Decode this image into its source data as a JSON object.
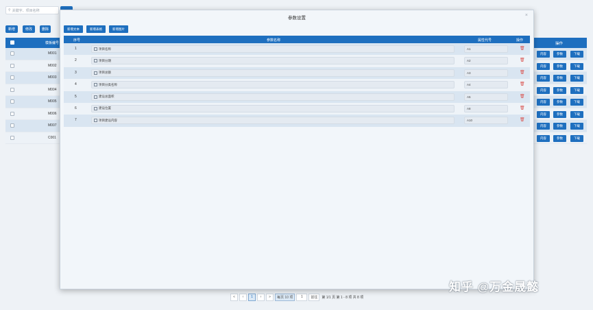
{
  "background": {
    "search": {
      "placeholder": "关键字、项目名称"
    },
    "toolbar": [
      "新增",
      "修改",
      "删除"
    ],
    "table": {
      "header_code": "模板编号",
      "header_actions": "操作",
      "rows": [
        {
          "code": "M001"
        },
        {
          "code": "M002"
        },
        {
          "code": "M003"
        },
        {
          "code": "M004"
        },
        {
          "code": "M005"
        },
        {
          "code": "M006"
        },
        {
          "code": "M007"
        },
        {
          "code": "C001"
        }
      ],
      "row_actions": [
        "内容",
        "参数",
        "下载"
      ]
    },
    "pagination": {
      "first": "«",
      "prev": "‹",
      "current": "1",
      "next": "›",
      "last": "»",
      "page_size": "每页 10 项",
      "goto_value": "1",
      "goto_button": "前往",
      "info": "第 1/1 页 第 1 - 8 项 共 8 项"
    }
  },
  "modal": {
    "title": "参数设置",
    "close": "×",
    "buttons": [
      "新增文本",
      "新增表格",
      "新增图片"
    ],
    "columns": {
      "index": "序号",
      "name": "参数名称",
      "code": "属性代号",
      "action": "操作"
    },
    "rows": [
      {
        "index": "1",
        "name": "项目名称",
        "code": "A1"
      },
      {
        "index": "2",
        "name": "项目分期",
        "code": "A2"
      },
      {
        "index": "3",
        "name": "项目总额",
        "code": "A3"
      },
      {
        "index": "4",
        "name": "项目分类名称",
        "code": "A4"
      },
      {
        "index": "5",
        "name": "建设总面积",
        "code": "A5"
      },
      {
        "index": "6",
        "name": "建设位置",
        "code": "A8"
      },
      {
        "index": "7",
        "name": "项目建设内容",
        "code": "A10"
      }
    ],
    "delete_icon": "🗑"
  },
  "watermark": "知乎 @万金晟懿"
}
